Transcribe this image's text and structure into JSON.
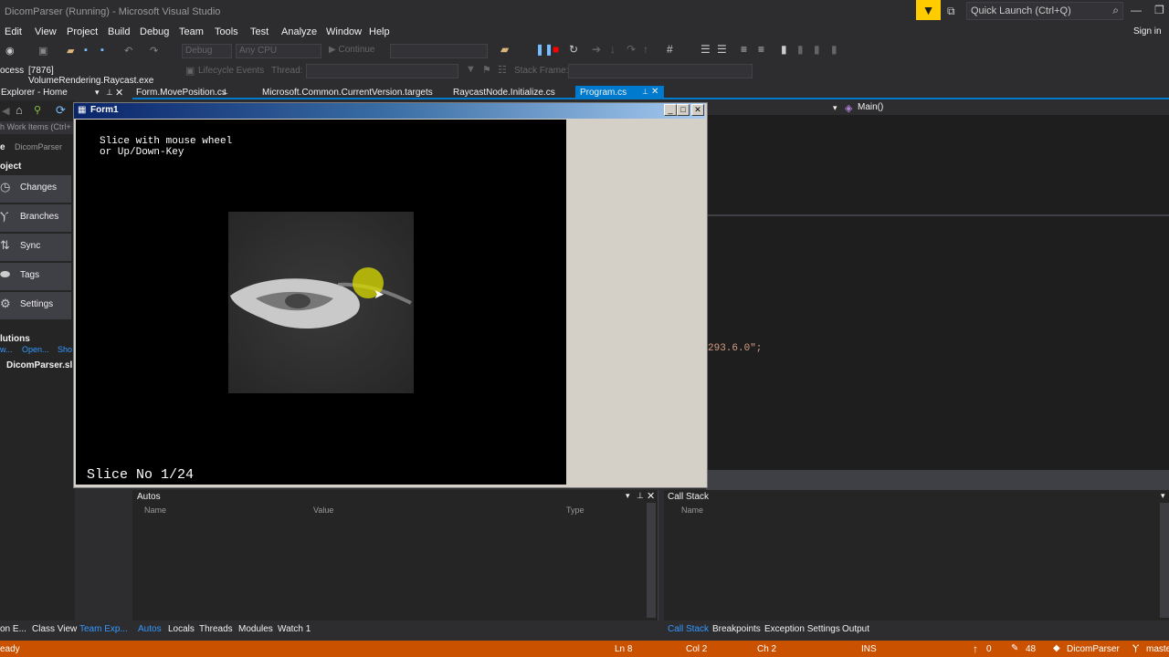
{
  "window": {
    "title": "DicomParser (Running) - Microsoft Visual Studio",
    "quick_launch_placeholder": "Quick Launch (Ctrl+Q)",
    "sign_in": "Sign in"
  },
  "menu": [
    "Edit",
    "View",
    "Project",
    "Build",
    "Debug",
    "Team",
    "Tools",
    "Test",
    "Analyze",
    "Window",
    "Help"
  ],
  "toolbar": {
    "config": "Debug",
    "platform": "Any CPU",
    "continue": "Continue"
  },
  "process_bar": {
    "label": "ocess:",
    "process": "[7876] VolumeRendering.Raycast.exe",
    "lifecycle": "Lifecycle Events",
    "thread": "Thread:",
    "stack_frame": "Stack Frame:"
  },
  "tabs": [
    {
      "label": "Explorer - Home"
    },
    {
      "label": "Form.MovePosition.cs"
    },
    {
      "label": "Microsoft.Common.CurrentVersion.targets"
    },
    {
      "label": "RaycastNode.Initialize.cs"
    },
    {
      "label": "Program.cs"
    }
  ],
  "left_panel": {
    "search": "h Work Items (Ctrl+",
    "home": "e",
    "repo": "DicomParser",
    "project": "oject",
    "items": [
      "Changes",
      "Branches",
      "Sync",
      "Tags",
      "Settings"
    ],
    "solutions": "lutions",
    "links": [
      "w...",
      "Open...",
      "Sho"
    ],
    "solution_file": "DicomParser.sl"
  },
  "code": {
    "member": "Main()",
    "snippet": "293.6.0\";"
  },
  "form1": {
    "title": "Form1",
    "instructions": [
      "Slice with mouse wheel",
      "or Up/Down-Key"
    ],
    "slice": "Slice No 1/24"
  },
  "autos": {
    "title": "Autos",
    "columns": [
      "Name",
      "Value",
      "Type"
    ],
    "tabs": [
      "Autos",
      "Locals",
      "Threads",
      "Modules",
      "Watch 1"
    ]
  },
  "callstack": {
    "title": "Call Stack",
    "columns": [
      "Name"
    ],
    "tabs": [
      "Call Stack",
      "Breakpoints",
      "Exception Settings",
      "Output"
    ]
  },
  "left_bottom_tabs": [
    "on E...",
    "Class View",
    "Team Exp..."
  ],
  "status": {
    "left": "eady",
    "ln": "Ln 8",
    "col": "Col 2",
    "ch": "Ch 2",
    "ins": "INS",
    "up": "0",
    "pencil": "48",
    "repo": "DicomParser",
    "branch": "maste"
  },
  "colors": {
    "accent": "#007acc",
    "status": "#ca5100",
    "filter": "#ffcc00"
  }
}
